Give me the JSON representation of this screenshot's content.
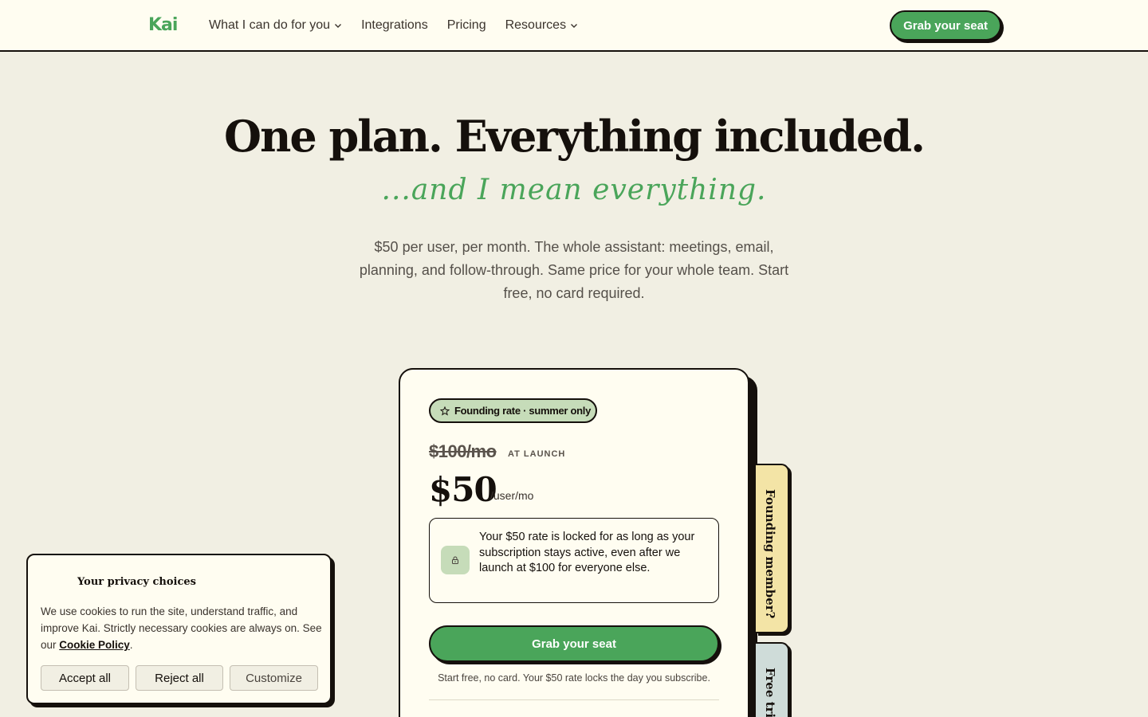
{
  "nav": {
    "logo": "Kai",
    "links": [
      {
        "label": "What I can do for you",
        "dropdown": true
      },
      {
        "label": "Integrations",
        "dropdown": false
      },
      {
        "label": "Pricing",
        "dropdown": false
      },
      {
        "label": "Resources",
        "dropdown": true
      }
    ],
    "cta": "Grab your seat"
  },
  "hero": {
    "title": "One plan. Everything included.",
    "script": "...and I mean everything.",
    "subtitle": "$50 per user, per month. The whole assistant: meetings, email, planning, and follow-through. Same price for your whole team. Start free, no card required."
  },
  "pricing": {
    "badge": "Founding rate · summer only",
    "old_price": "$100/mo",
    "old_price_note": "AT LAUNCH",
    "price": "$50",
    "per": "/user/mo",
    "lock_text": "Your $50 rate is locked for as long as your subscription stays active, even after we launch at $100 for everyone else.",
    "cta": "Grab your seat",
    "note": "Start free, no card. Your $50 rate locks the day you subscribe."
  },
  "tabs": [
    {
      "label": "Founding member?"
    },
    {
      "label": "Free trial"
    }
  ],
  "cookie": {
    "title": "Your privacy choices",
    "text": "We use cookies to run the site, understand traffic, and improve Kai. Strictly necessary cookies are always on. See our ",
    "link": "Cookie Policy",
    "period": ".",
    "accept": "Accept all",
    "reject": "Reject all",
    "customize": "Customize"
  },
  "colors": {
    "brand_green": "#4aa55a",
    "ink": "#15100c",
    "page_bg": "#f1efe3",
    "card_bg": "#fffdf1"
  },
  "icons": [
    "chevron-down-icon",
    "star-icon",
    "lock-icon"
  ]
}
